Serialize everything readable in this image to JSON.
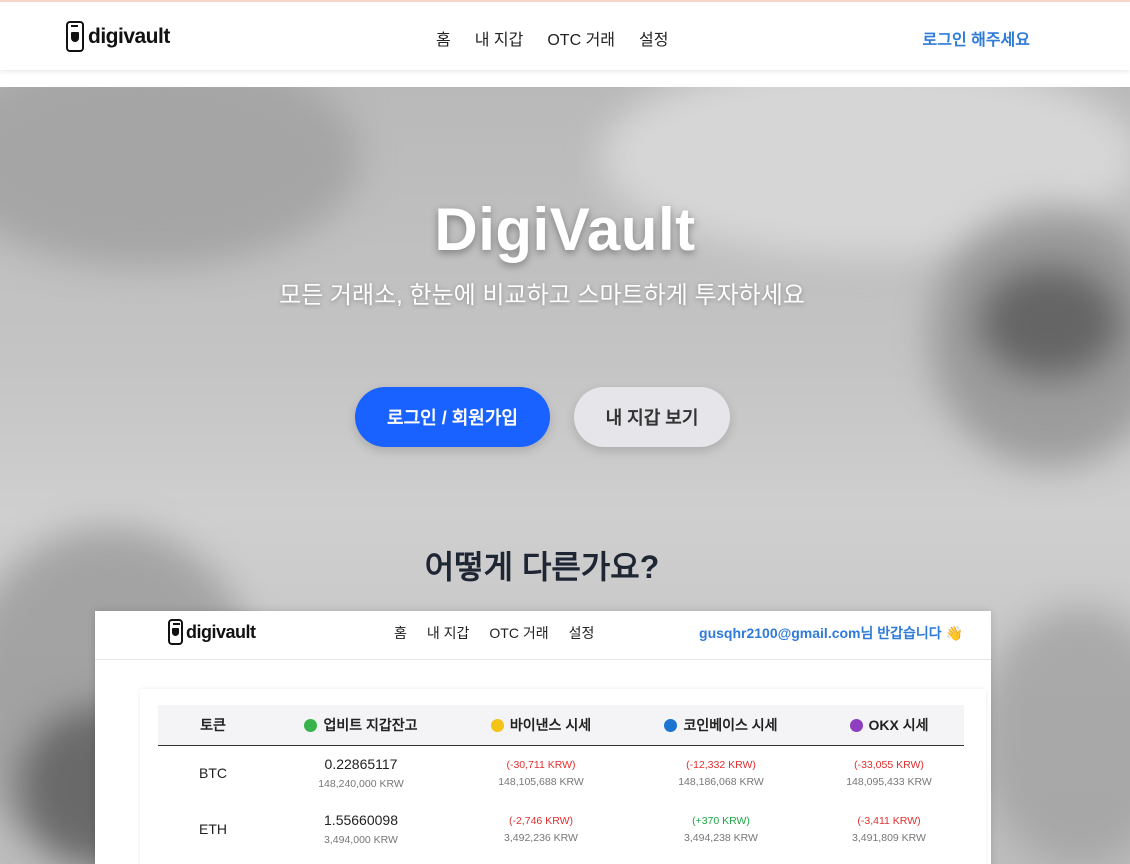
{
  "brand": {
    "name": "digivault"
  },
  "nav": {
    "items": [
      "홈",
      "내 지갑",
      "OTC 거래",
      "설정"
    ],
    "login": "로그인 해주세요"
  },
  "hero": {
    "title": "DigiVault",
    "subtitle": "모든 거래소, 한눈에 비교하고 스마트하게 투자하세요",
    "primary_button": "로그인 / 회원가입",
    "secondary_button": "내 지갑 보기",
    "section_title": "어떻게 다른가요?"
  },
  "preview": {
    "brand": "digivault",
    "nav": [
      "홈",
      "내 지갑",
      "OTC 거래",
      "설정"
    ],
    "greeting": "gusqhr2100@gmail.com님 반갑습니다 👋",
    "columns": [
      {
        "label": "토큰",
        "dot": ""
      },
      {
        "label": "업비트 지갑잔고",
        "dot": "#37b34a"
      },
      {
        "label": "바이낸스 시세",
        "dot": "#f3c316"
      },
      {
        "label": "코인베이스 시세",
        "dot": "#1c73d2"
      },
      {
        "label": "OKX 시세",
        "dot": "#8e3fbf"
      }
    ],
    "rows": [
      {
        "token": "BTC",
        "balance": "0.22865117",
        "balance_krw": "148,240,000 KRW",
        "binance": {
          "diff": "(-30,711 KRW)",
          "price": "148,105,688 KRW",
          "sign": "neg"
        },
        "coinbase": {
          "diff": "(-12,332 KRW)",
          "price": "148,186,068 KRW",
          "sign": "neg"
        },
        "okx": {
          "diff": "(-33,055 KRW)",
          "price": "148,095,433 KRW",
          "sign": "neg"
        }
      },
      {
        "token": "ETH",
        "balance": "1.55660098",
        "balance_krw": "3,494,000 KRW",
        "binance": {
          "diff": "(-2,746 KRW)",
          "price": "3,492,236 KRW",
          "sign": "neg"
        },
        "coinbase": {
          "diff": "(+370 KRW)",
          "price": "3,494,238 KRW",
          "sign": "pos"
        },
        "okx": {
          "diff": "(-3,411 KRW)",
          "price": "3,491,809 KRW",
          "sign": "neg"
        }
      }
    ]
  }
}
